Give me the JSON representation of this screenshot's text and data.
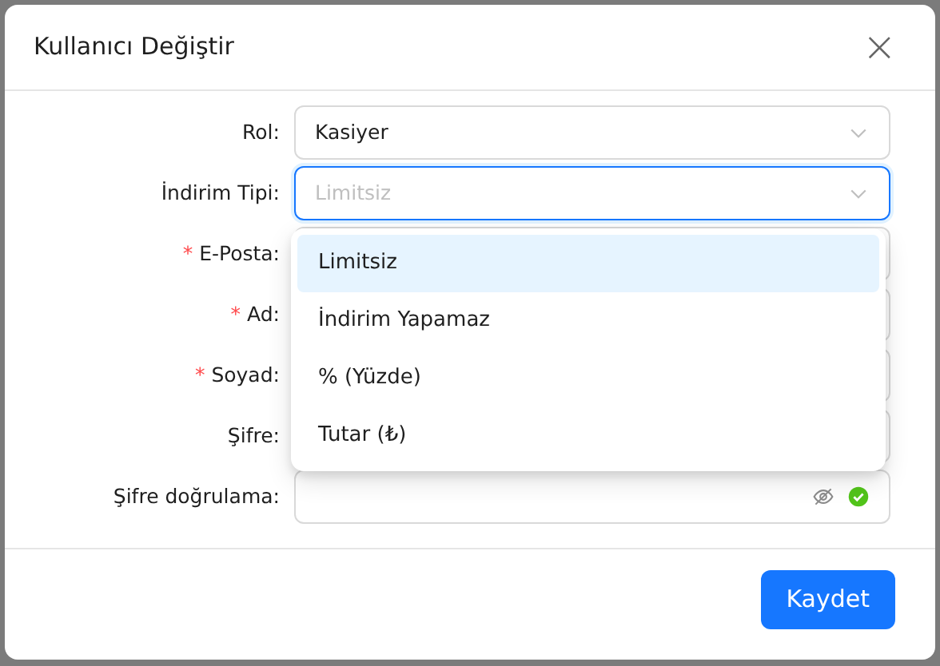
{
  "dialog": {
    "title": "Kullanıcı Değiştir",
    "close": "×"
  },
  "fields": [
    {
      "kind": "select",
      "label": "Rol:",
      "value": "Kasiyer",
      "focused": false
    },
    {
      "kind": "select",
      "label": "İndirim Tipi:",
      "placeholder": "Limitsiz",
      "focused": true,
      "open": true
    },
    {
      "kind": "text",
      "label": "E-Posta:",
      "mark": "*"
    },
    {
      "kind": "text",
      "label": "Ad:",
      "mark": "*"
    },
    {
      "kind": "text",
      "label": "Soyad:",
      "mark": "*"
    },
    {
      "kind": "password",
      "label": "Şifre:"
    },
    {
      "kind": "password",
      "label": "Şifre doğrulama:",
      "focused": false,
      "valid": true
    }
  ],
  "dropdown": {
    "options": [
      {
        "label": "Limitsiz",
        "selected": true
      },
      {
        "label": "İndirim Yapamaz",
        "selected": false
      },
      {
        "label": "% (Yüzde)",
        "selected": false
      },
      {
        "label": "Tutar (₺)",
        "selected": false
      }
    ]
  },
  "buttons": [
    {
      "label": "Kaydet",
      "kind": "primary"
    }
  ]
}
